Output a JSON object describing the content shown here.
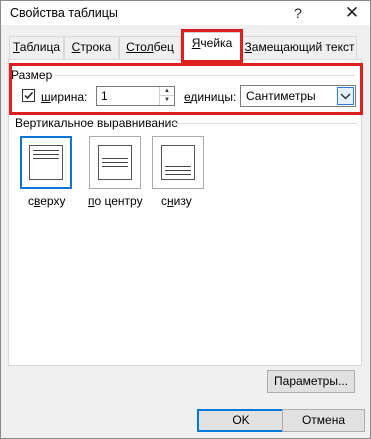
{
  "window": {
    "title": "Свойства таблицы",
    "help_glyph": "?",
    "close_glyph": "✕"
  },
  "tabs": [
    {
      "label": "Таблица",
      "underline": "Т",
      "rest": "аблица",
      "active": false
    },
    {
      "label": "Строка",
      "underline": "С",
      "rest": "трока",
      "active": false
    },
    {
      "label": "Столбец",
      "underline": "Стол",
      "rest": "бец",
      "active": false
    },
    {
      "label": "Ячейка",
      "underline": "Я",
      "rest": "чейка",
      "active": true
    },
    {
      "label": "Замещающий текст",
      "underline": "З",
      "rest": "амещающий текст",
      "active": false
    }
  ],
  "size_group": {
    "label": "Размер",
    "width_checkbox_checked": true,
    "width_label": "ширина:",
    "width_label_underline": "ш",
    "width_label_rest": "ирина:",
    "width_value": "1",
    "units_label": "единицы:",
    "units_label_underline": "е",
    "units_label_rest": "диницы:",
    "units_value": "Сантиметры"
  },
  "vertical_alignment": {
    "label": "Вертикальное выравнивание",
    "options": [
      {
        "label": "сверху",
        "underline": "в",
        "pre": "с",
        "post": "ерху",
        "icon": "align-top-icon",
        "selected": true
      },
      {
        "label": "по центру",
        "underline": "п",
        "pre": "",
        "post": "о центру",
        "icon": "align-center-icon",
        "selected": false
      },
      {
        "label": "снизу",
        "underline": "н",
        "pre": "с",
        "post": "изу",
        "icon": "align-bottom-icon",
        "selected": false
      }
    ]
  },
  "buttons": {
    "options": "Параметры...",
    "ok": "OK",
    "cancel": "Отмена"
  },
  "colors": {
    "highlight_red": "#e02020",
    "selection_blue": "#0a74d4"
  }
}
